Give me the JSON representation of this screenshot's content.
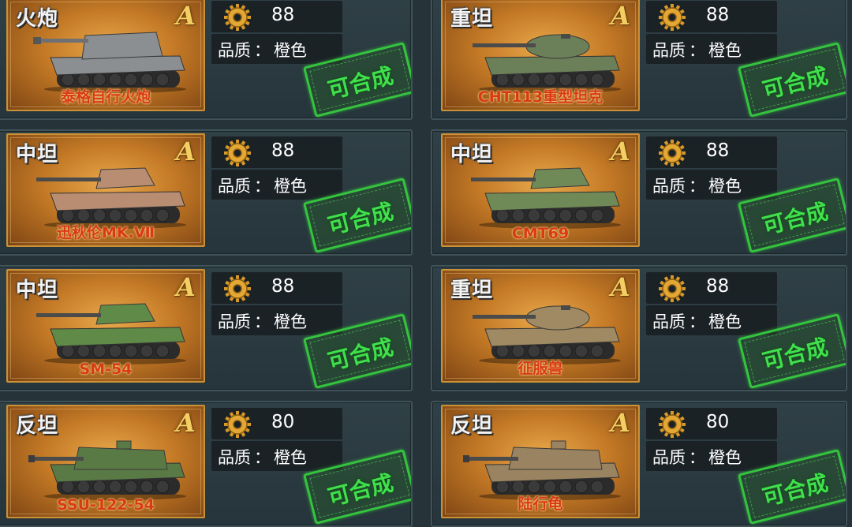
{
  "cards": [
    {
      "type": "火炮",
      "grade": "A",
      "name": "泰格自行火炮",
      "cost": "88",
      "quality_label": "品质",
      "quality_value": "橙色",
      "status": "可合成",
      "hull": "#8c8f92",
      "tank_kind": "spg"
    },
    {
      "type": "重坦",
      "grade": "A",
      "name": "CHT113重型坦克",
      "cost": "88",
      "quality_label": "品质",
      "quality_value": "橙色",
      "status": "可合成",
      "hull": "#6b7f58",
      "tank_kind": "heavy"
    },
    {
      "type": "中坦",
      "grade": "A",
      "name": "迅秋伦MK.Ⅶ",
      "cost": "88",
      "quality_label": "品质",
      "quality_value": "橙色",
      "status": "可合成",
      "hull": "#b88d72",
      "tank_kind": "medium"
    },
    {
      "type": "中坦",
      "grade": "A",
      "name": "CMT69",
      "cost": "88",
      "quality_label": "品质",
      "quality_value": "橙色",
      "status": "可合成",
      "hull": "#6f8a56",
      "tank_kind": "medium"
    },
    {
      "type": "中坦",
      "grade": "A",
      "name": "SM-54",
      "cost": "88",
      "quality_label": "品质",
      "quality_value": "橙色",
      "status": "可合成",
      "hull": "#5f8a47",
      "tank_kind": "medium"
    },
    {
      "type": "重坦",
      "grade": "A",
      "name": "征服兽",
      "cost": "88",
      "quality_label": "品质",
      "quality_value": "橙色",
      "status": "可合成",
      "hull": "#a08a63",
      "tank_kind": "heavy"
    },
    {
      "type": "反坦",
      "grade": "A",
      "name": "SSU-122-54",
      "cost": "80",
      "quality_label": "品质",
      "quality_value": "橙色",
      "status": "可合成",
      "hull": "#5a7a45",
      "tank_kind": "td"
    },
    {
      "type": "反坦",
      "grade": "A",
      "name": "陆行龟",
      "cost": "80",
      "quality_label": "品质",
      "quality_value": "橙色",
      "status": "可合成",
      "hull": "#9a8360",
      "tank_kind": "td"
    }
  ]
}
